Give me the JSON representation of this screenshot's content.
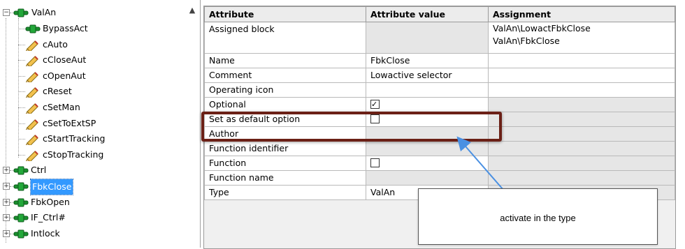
{
  "tree": {
    "root": "ValAn",
    "items": [
      "BypassAct",
      "cAuto",
      "cCloseAut",
      "cOpenAut",
      "cReset",
      "cSetMan",
      "cSetToExtSP",
      "cStartTracking",
      "cStopTracking",
      "Ctrl",
      "FbkClose",
      "FbkOpen",
      "IF_Ctrl#",
      "Intlock"
    ],
    "selected": "FbkClose",
    "scroll_up_icon": "▲"
  },
  "grid": {
    "headers": [
      "Attribute",
      "Attribute value",
      "Assignment"
    ],
    "rows": [
      {
        "attribute": "Assigned block",
        "value": "",
        "assignment": [
          "ValAn\\LowactFbkClose",
          "ValAn\\FbkClose"
        ]
      },
      {
        "attribute": "Name",
        "value": "FbkClose",
        "assignment": []
      },
      {
        "attribute": "Comment",
        "value": "Lowactive selector",
        "assignment": []
      },
      {
        "attribute": "Operating icon",
        "value": "",
        "assignment": []
      },
      {
        "attribute": "Optional",
        "value": "checkbox-checked",
        "assignment": []
      },
      {
        "attribute": "Set as default option",
        "value": "checkbox-unchecked",
        "assignment": []
      },
      {
        "attribute": "Author",
        "value": "",
        "assignment": []
      },
      {
        "attribute": "Function identifier",
        "value": "",
        "assignment": []
      },
      {
        "attribute": "Function",
        "value": "checkbox-unchecked",
        "assignment": []
      },
      {
        "attribute": "Function name",
        "value": "",
        "assignment": []
      },
      {
        "attribute": "Type",
        "value": "ValAn",
        "assignment": []
      }
    ]
  },
  "callout": {
    "text": "activate in the type"
  },
  "colors": {
    "highlight_border": "#6b2016",
    "arrow": "#4a90e2",
    "selection": "#3399ff"
  }
}
